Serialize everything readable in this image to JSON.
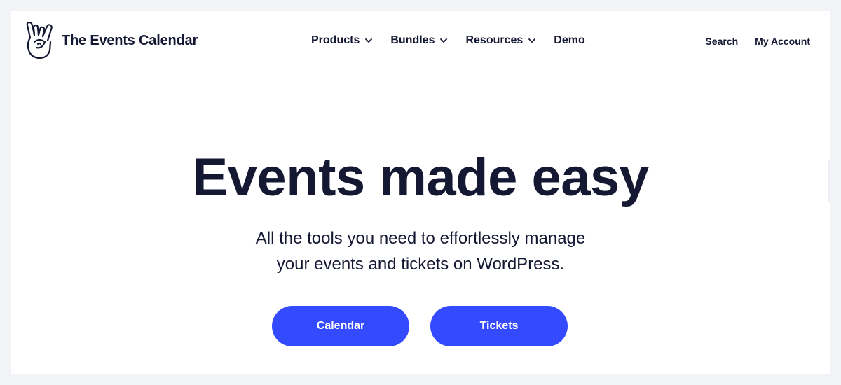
{
  "brand": {
    "name": "The Events Calendar",
    "logo_icon": "rock-hand-icon"
  },
  "nav": {
    "items": [
      {
        "label": "Products",
        "has_dropdown": true
      },
      {
        "label": "Bundles",
        "has_dropdown": true
      },
      {
        "label": "Resources",
        "has_dropdown": true
      },
      {
        "label": "Demo",
        "has_dropdown": false
      }
    ]
  },
  "utility": {
    "search_label": "Search",
    "account_label": "My Account"
  },
  "hero": {
    "title": "Events made easy",
    "subtitle_line1": "All the tools you need to effortlessly manage",
    "subtitle_line2": "your events and tickets on WordPress."
  },
  "cta": {
    "calendar_label": "Calendar",
    "tickets_label": "Tickets"
  },
  "colors": {
    "text": "#141833",
    "accent": "#334aff",
    "page_bg": "#f2f3f6",
    "card_bg": "#ffffff"
  }
}
